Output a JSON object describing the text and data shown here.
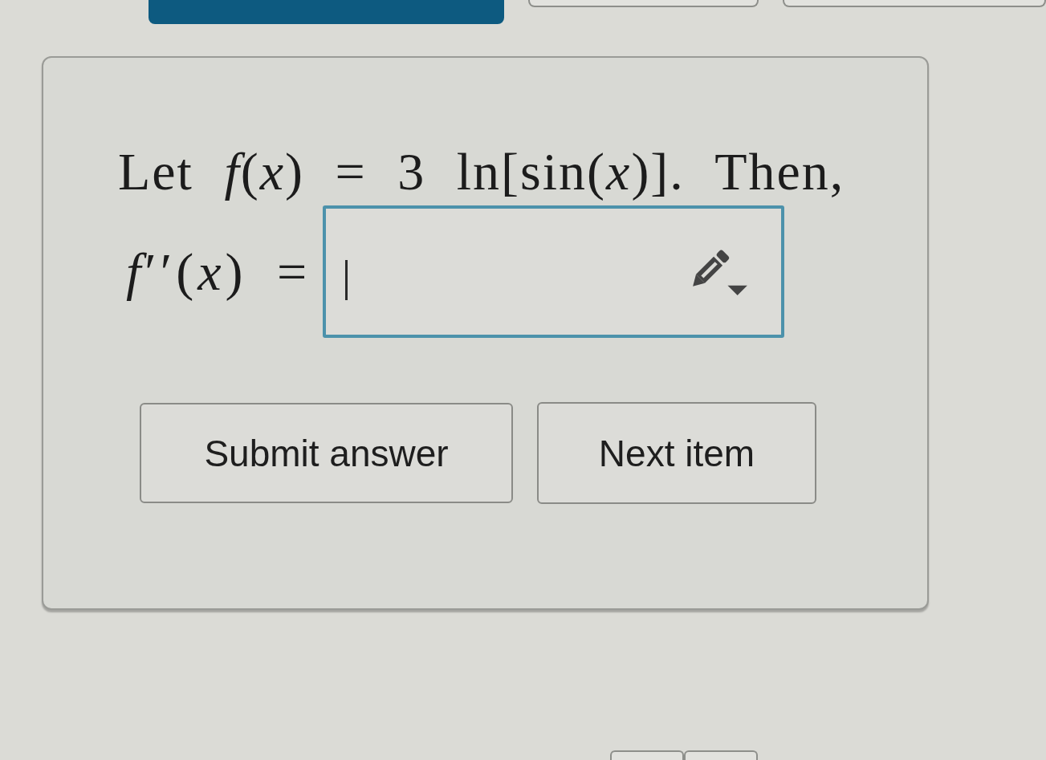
{
  "top_tabs": [
    {
      "selected": true
    },
    {
      "selected": false
    },
    {
      "selected": false
    }
  ],
  "question": {
    "prompt": "Let *f*(*x*) = 3 ln[sin(*x*)]. Then,"
  },
  "answer": {
    "label": "*f*′′(*x*) =",
    "focused": true
  },
  "buttons": [
    {
      "kind": "submit",
      "label": "Submit answer"
    },
    {
      "kind": "next",
      "label": "Next item"
    }
  ],
  "bottom_tabs": [
    {
      "selected": false
    },
    {
      "selected": false
    }
  ]
}
